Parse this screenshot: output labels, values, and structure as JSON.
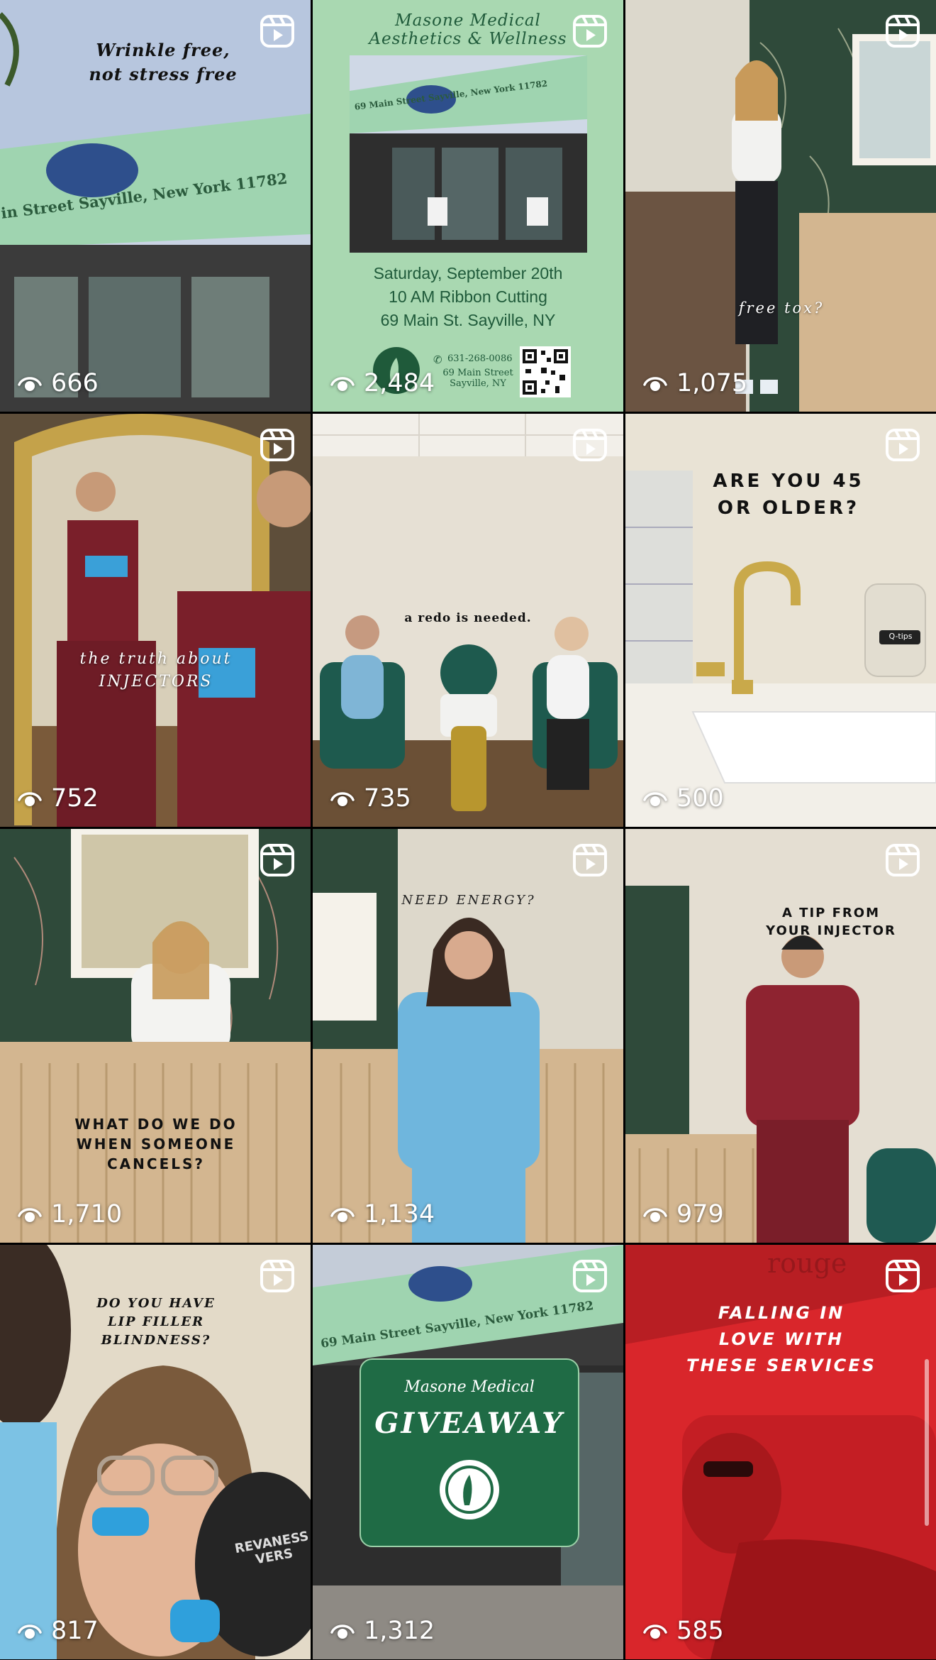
{
  "tiles": [
    {
      "views": "666",
      "caption": "Wrinkle free,\nnot stress free",
      "sign": "in Street Sayville, New York 11782"
    },
    {
      "views": "2,484",
      "title": "Masone Medical\nAesthetics & Wellness",
      "sign": "69 Main Street Sayville, New York 11782",
      "event_line1": "Saturday, September 20th",
      "event_line2": "10 AM Ribbon Cutting",
      "event_line3": "69 Main St. Sayville, NY",
      "phone": "631-268-0086",
      "address": "69 Main Street\nSayville, NY"
    },
    {
      "views": "1,075",
      "caption": "free tox?"
    },
    {
      "views": "752",
      "caption": "the truth about\nINJECTORS"
    },
    {
      "views": "735",
      "caption": "a redo is needed."
    },
    {
      "views": "500",
      "caption": "ARE YOU 45\nOR OLDER?",
      "jar_label": "Q-tips"
    },
    {
      "views": "1,710",
      "caption": "WHAT DO WE DO\nWHEN SOMEONE\nCANCELS?"
    },
    {
      "views": "1,134",
      "caption": "NEED ENERGY?"
    },
    {
      "views": "979",
      "caption": "A TIP FROM\nYOUR INJECTOR"
    },
    {
      "views": "817",
      "caption": "DO YOU HAVE\nLIP FILLER\nBLINDNESS?",
      "mirror_text": "REVANESS\nVERS"
    },
    {
      "views": "1,312",
      "card_title": "Masone Medical",
      "card_main": "GIVEAWAY",
      "sign": "69 Main Street Sayville, New York 11782"
    },
    {
      "views": "585",
      "caption": "FALLING IN\nLOVE WITH\nTHESE SERVICES",
      "sign": "rouge"
    }
  ],
  "colors": {
    "accent_green": "#1f6b45",
    "mint": "#a9d8b1",
    "red": "#d8262a"
  }
}
